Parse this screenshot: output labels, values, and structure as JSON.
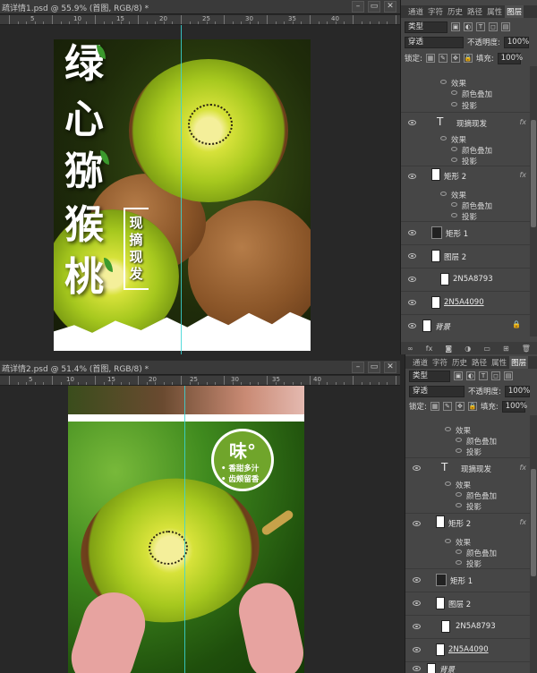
{
  "doc1": {
    "title": "疏详情1.psd @ 55.9% (首图, RGB/8) *",
    "ruler_numbers": [
      "5",
      "10",
      "15",
      "20",
      "25",
      "30",
      "35",
      "40"
    ]
  },
  "doc2": {
    "title": "疏详情2.psd @ 51.4% (首图, RGB/8) *",
    "ruler_numbers": [
      "5",
      "10",
      "15",
      "20",
      "25",
      "30",
      "35",
      "40"
    ]
  },
  "window_buttons": {
    "minimize": "–",
    "restore": "▭",
    "close": "✕"
  },
  "art1": {
    "title_chars": [
      "绿",
      "心",
      "猕",
      "猴",
      "桃"
    ],
    "vertical_tag": "现摘现发"
  },
  "art2": {
    "badge_big": "味°",
    "badge_line1": "• 香甜多汁",
    "badge_line2": "• 齿颊留香"
  },
  "panel": {
    "tabs": [
      "通道",
      "字符",
      "历史",
      "路径",
      "属性",
      "图层"
    ],
    "active_tab": "图层",
    "filter_select": "类型",
    "blend_mode": "穿透",
    "opacity_label": "不透明度:",
    "opacity_value": "100%",
    "lock_label": "锁定:",
    "fill_label": "填充:",
    "fill_value": "100%",
    "fx_label": "fx",
    "effects_label": "效果",
    "color_overlay": "颜色叠加",
    "drop_shadow": "投影",
    "layer_names": {
      "text_layer": "现摘现发",
      "rect2": "矩形 2",
      "rect1": "矩形 1",
      "layer2": "图层 2",
      "img1": "2N5A8793",
      "img2": "2N5A4090",
      "background": "背景"
    },
    "text_icon": "T"
  },
  "colors": {
    "guide": "#39d6d6",
    "badge_green": "#70a52b",
    "panel_bg": "#464646"
  }
}
